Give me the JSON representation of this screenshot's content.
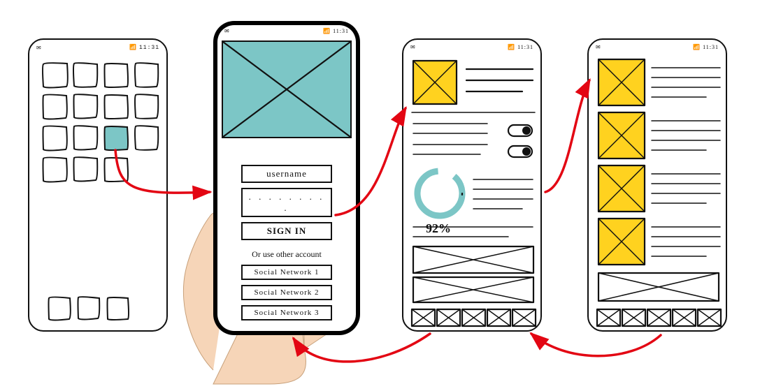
{
  "status": {
    "time": "11:31",
    "mail_icon": "mail-icon",
    "signal_icon": "signal-icon"
  },
  "login": {
    "username_label": "username",
    "password_dots": ". . . . . . . . .",
    "signin_label": "SIGN IN",
    "alt_prompt": "Or use other account",
    "social1": "Social Network 1",
    "social2": "Social Network 2",
    "social3": "Social Network 3"
  },
  "dashboard": {
    "progress_label": "92%"
  },
  "colors": {
    "accent_teal": "#7CC6C6",
    "accent_yellow": "#FFD21F",
    "arrow": "#E30613"
  }
}
